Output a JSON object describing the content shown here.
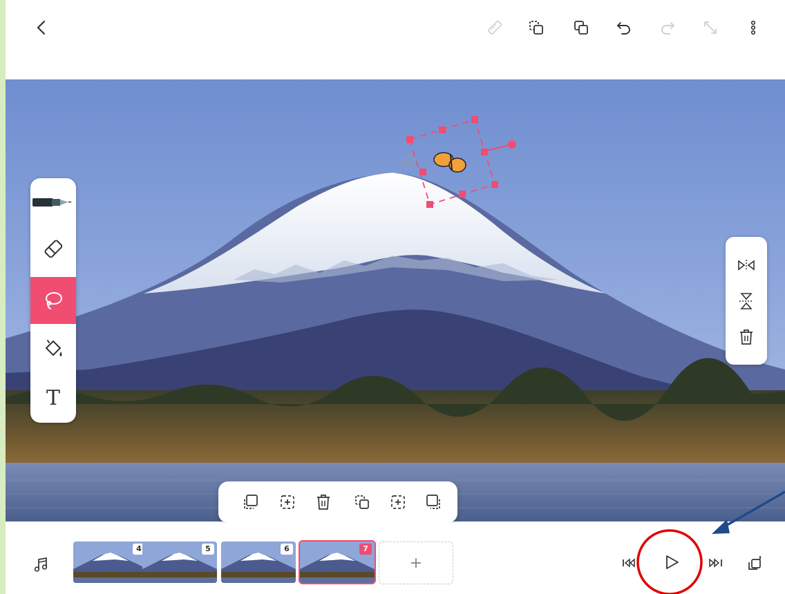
{
  "frame_border_color": "#d8ecc1",
  "accent_color": "#f04d71",
  "top_toolbar": {
    "icons": [
      "back-chevron-icon",
      "ruler-icon",
      "copy-dashed-icon",
      "duplicate-icon",
      "undo-icon",
      "redo-icon",
      "expand-icon",
      "more-vertical-icon"
    ]
  },
  "tool_palette": {
    "items": [
      "pen-tool",
      "eraser-tool",
      "lasso-tool",
      "fill-bucket-tool",
      "text-tool"
    ],
    "active": "lasso-tool",
    "text_tool_glyph": "T"
  },
  "selection_actions": {
    "icons": [
      "flip-horizontal-icon",
      "flip-vertical-icon",
      "delete-icon"
    ]
  },
  "frame_popover": {
    "icons": [
      "copy-frame-icon",
      "insert-frame-icon",
      "delete-frame-icon",
      "duplicate-frame-icon",
      "insert-blank-icon",
      "paste-frame-icon"
    ]
  },
  "timeline": {
    "frames": [
      {
        "number": "4",
        "active": false
      },
      {
        "number": "5",
        "active": false
      },
      {
        "number": "6",
        "active": false
      },
      {
        "number": "7",
        "active": true
      }
    ],
    "add_label": "+"
  },
  "playback": {
    "icons": [
      "music-icon",
      "first-frame-icon",
      "play-icon",
      "last-frame-icon",
      "onion-skin-icon"
    ]
  },
  "annotation": {
    "circle_color": "#e00000",
    "arrow_color": "#1f4a8c"
  }
}
